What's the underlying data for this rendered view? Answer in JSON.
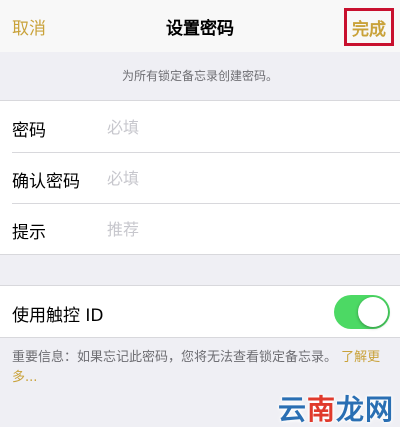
{
  "navbar": {
    "cancel_label": "取消",
    "title": "设置密码",
    "done_label": "完成"
  },
  "hint": "为所有锁定备忘录创建密码。",
  "form": {
    "password": {
      "label": "密码",
      "placeholder": "必填"
    },
    "confirm": {
      "label": "确认密码",
      "placeholder": "必填"
    },
    "hint_field": {
      "label": "提示",
      "placeholder": "推荐"
    }
  },
  "touch_id": {
    "label": "使用触控 ID",
    "enabled": true
  },
  "footer": {
    "text": "重要信息：如果忘记此密码，您将无法查看锁定备忘录。",
    "link": "了解更多..."
  },
  "watermark": {
    "part1": "云",
    "part2": "南",
    "part3": "龙网"
  },
  "colors": {
    "accent": "#c9a23a",
    "toggle_on": "#4cd964",
    "highlight_box": "#c8102e"
  }
}
